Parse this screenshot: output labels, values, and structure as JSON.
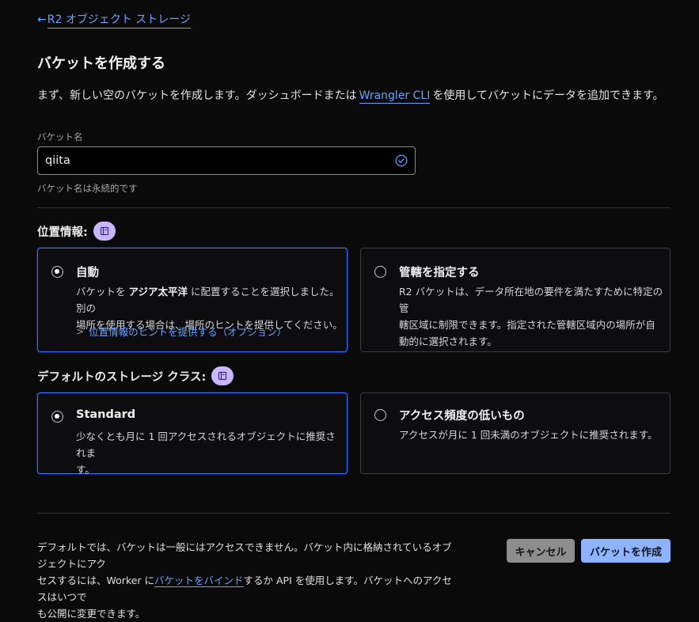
{
  "back_link": {
    "arrow": "←",
    "label": "R2 オブジェクト ストレージ"
  },
  "page_title": "バケットを作成する",
  "intro": {
    "before": "まず、新しい空のバケットを作成します。ダッシュボードまたは",
    "link": "Wrangler CLI",
    "after": "を使用してバケットにデータを追加できます。"
  },
  "bucket_name": {
    "label": "バケット名",
    "value": "qiita",
    "help": "バケット名は永続的です",
    "valid_icon": "check-circle-icon"
  },
  "location": {
    "title": "位置情報:",
    "info_icon": "book-icon",
    "options": [
      {
        "title": "自動",
        "selected": true,
        "desc_prefix": "バケットを",
        "desc_region": "アジア太平洋",
        "desc_line1_rest": "に配置することを選択しました。別の",
        "desc_line2": "場所を使用する場合は、場所のヒントを提供してください。",
        "hint_link": "位置情報のヒントを提供する（オプション）"
      },
      {
        "title": "管轄を指定する",
        "selected": false,
        "desc_line1": "R2 バケットは、データ所在地の要件を満たすために特定の管",
        "desc_line2": "轄区域に制限できます。指定された管轄区域内の場所が自",
        "desc_line3": "動的に選択されます。"
      }
    ]
  },
  "storage_class": {
    "title": "デフォルトのストレージ クラス:",
    "info_icon": "book-icon",
    "options": [
      {
        "title": "Standard",
        "selected": true,
        "desc_line1": "少なくとも月に 1 回アクセスされるオブジェクトに推奨されま",
        "desc_line2": "す。"
      },
      {
        "title": "アクセス頻度の低いもの",
        "selected": false,
        "desc_line1": "アクセスが月に 1 回未満のオブジェクトに推奨されます。"
      }
    ]
  },
  "footer": {
    "line1": "デフォルトでは、バケットは一般にはアクセスできません。バケット内に格納されているオブジェクトにアク",
    "line2_before": "セスするには、Worker に",
    "line2_link": "バケットをバインド",
    "line2_after": "するか API を使用します。バケットへのアクセスはいつで",
    "line3": "も公開に変更できます。",
    "cancel_label": "キャンセル",
    "create_label": "バケットを作成"
  },
  "colors": {
    "accent": "#6ea1ff",
    "selected_border": "#3b6dff",
    "info_badge": "#c9b6ff",
    "primary_button": "#8fb4ff"
  }
}
